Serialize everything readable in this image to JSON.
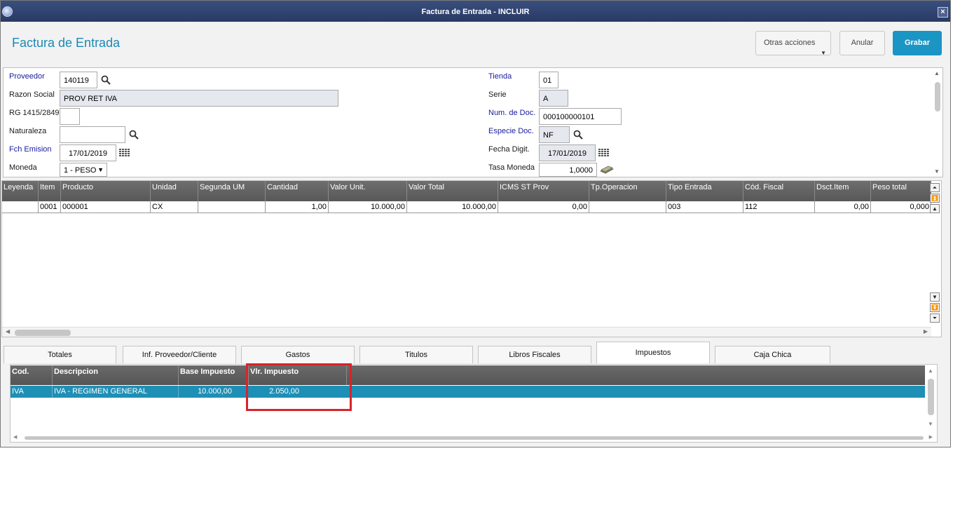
{
  "window": {
    "title": "Factura de Entrada - INCLUIR",
    "close_label": "×"
  },
  "header": {
    "page_title": "Factura de Entrada",
    "otras_label": "Otras acciones",
    "anular_label": "Anular",
    "grabar_label": "Grabar"
  },
  "form": {
    "proveedor": {
      "label": "Proveedor",
      "value": "140119"
    },
    "razon_social": {
      "label": "Razon Social",
      "value": "PROV RET IVA"
    },
    "rg": {
      "label": "RG 1415/2849",
      "value": ""
    },
    "naturaleza": {
      "label": "Naturaleza",
      "value": ""
    },
    "fch_emision": {
      "label": "Fch Emision",
      "value": "17/01/2019"
    },
    "moneda": {
      "label": "Moneda",
      "value": "1 - PESO"
    },
    "tienda": {
      "label": "Tienda",
      "value": "01"
    },
    "serie": {
      "label": "Serie",
      "value": "A"
    },
    "num_doc": {
      "label": "Num. de Doc.",
      "value": "000100000101"
    },
    "especie_doc": {
      "label": "Especie Doc.",
      "value": "NF"
    },
    "fecha_digit": {
      "label": "Fecha Digit.",
      "value": "17/01/2019"
    },
    "tasa_moneda": {
      "label": "Tasa Moneda",
      "value": "1,0000"
    }
  },
  "items_grid": {
    "columns": [
      "Leyenda",
      "Item",
      "Producto",
      "Unidad",
      "Segunda UM",
      "Cantidad",
      "Valor Unit.",
      "Valor Total",
      "ICMS ST Prov",
      "Tp.Operacion",
      "Tipo Entrada",
      "Cód. Fiscal",
      "Dsct.Item",
      "Peso total"
    ],
    "rows": [
      [
        "",
        "0001",
        "000001",
        "CX",
        "",
        "1,00",
        "10.000,00",
        "10.000,00",
        "0,00",
        "",
        "003",
        "112",
        "0,00",
        "0,000"
      ]
    ]
  },
  "tabs": [
    "Totales",
    "Inf. Proveedor/Cliente",
    "Gastos",
    "Titulos",
    "Libros Fiscales",
    "Impuestos",
    "Caja Chica"
  ],
  "active_tab": "Impuestos",
  "tax_grid": {
    "columns": [
      "Cod.",
      "Descripcion",
      "Base Impuesto",
      "Vlr. Impuesto"
    ],
    "rows": [
      [
        "IVA",
        "IVA - REGIMEN GENERAL",
        "10.000,00",
        "2.050,00"
      ]
    ]
  },
  "colors": {
    "title_accent": "#1a8ab5",
    "primary_button": "#1b95c4",
    "selected_row": "#1e8fb5",
    "highlight_box": "#d9232a",
    "required_label": "#1a1aa0"
  },
  "icons": {
    "search": "magnifier-icon",
    "calendar": "calendar-grid-icon",
    "money": "banknote-icon",
    "dropdown": "chevron-down-icon"
  }
}
